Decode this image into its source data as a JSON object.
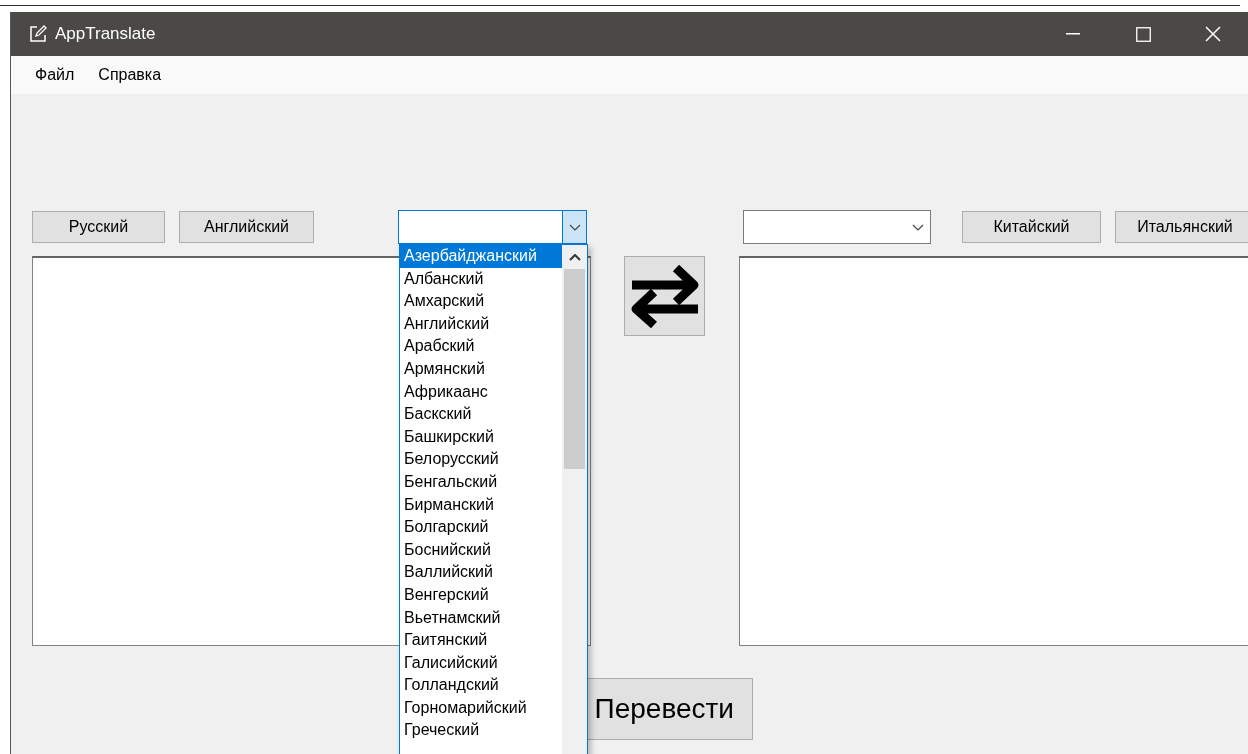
{
  "window": {
    "title": "AppTranslate"
  },
  "menu": [
    "Файл",
    "Справка"
  ],
  "source": {
    "quick_languages": [
      "Русский",
      "Английский"
    ]
  },
  "dropdown": {
    "items": [
      {
        "label": "Азербайджанский",
        "selected": true
      },
      {
        "label": "Албанский",
        "selected": false
      },
      {
        "label": "Амхарский",
        "selected": false
      },
      {
        "label": "Английский",
        "selected": false
      },
      {
        "label": "Арабский",
        "selected": false
      },
      {
        "label": "Армянский",
        "selected": false
      },
      {
        "label": "Африкаанс",
        "selected": false
      },
      {
        "label": "Баскский",
        "selected": false
      },
      {
        "label": "Башкирский",
        "selected": false
      },
      {
        "label": "Белорусский",
        "selected": false
      },
      {
        "label": "Бенгальский",
        "selected": false
      },
      {
        "label": "Бирманский",
        "selected": false
      },
      {
        "label": "Болгарский",
        "selected": false
      },
      {
        "label": "Боснийский",
        "selected": false
      },
      {
        "label": "Валлийский",
        "selected": false
      },
      {
        "label": "Венгерский",
        "selected": false
      },
      {
        "label": "Вьетнамский",
        "selected": false
      },
      {
        "label": "Гаитянский",
        "selected": false
      },
      {
        "label": "Галисийский",
        "selected": false
      },
      {
        "label": "Голландский",
        "selected": false
      },
      {
        "label": "Горномарийский",
        "selected": false
      },
      {
        "label": "Греческий",
        "selected": false
      }
    ]
  },
  "target": {
    "quick_languages": [
      "Китайский",
      "Итальянский"
    ]
  },
  "translate_button": "Перевести"
}
